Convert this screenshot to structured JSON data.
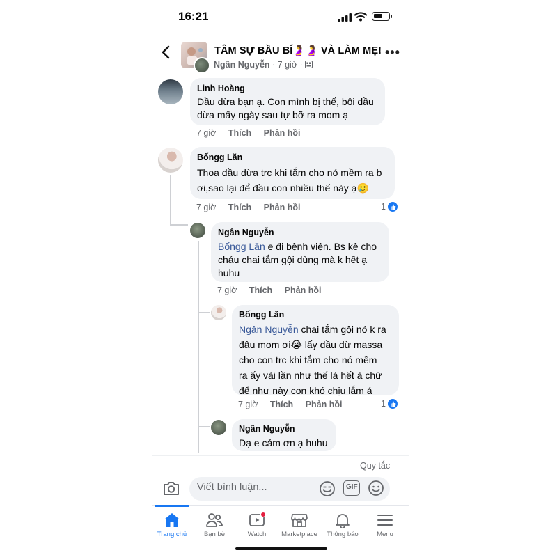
{
  "status_bar": {
    "time": "16:21"
  },
  "header": {
    "title": "TÂM SỰ BẦU BÍ🤰🤰 VÀ LÀM MẸ!",
    "author": "Ngân Nguyễn",
    "subtitle_time": " · 7 giờ · "
  },
  "comments": [
    {
      "name": "Linh Hoàng",
      "lines": [
        "Dầu dừa bạn ạ. Con mình bị thế, bôi dầu",
        "dừa mấy ngày sau tự bỡ ra mom ạ"
      ],
      "time": "7 giờ",
      "like": "Thích",
      "reply": "Phản hồi"
    },
    {
      "name": "Bốngg Lăn",
      "lines": [
        "Thoa dầu dừa trc khi tắm cho nó mềm ra b",
        "ơi,sao lại để đầu con nhiều thế này ạ🥲"
      ],
      "time": "7 giờ",
      "like": "Thích",
      "reply": "Phản hồi",
      "reactions": "1"
    },
    {
      "name": "Ngân Nguyễn",
      "mention": "Bốngg Lăn",
      "lines": [
        " e đi bệnh viện. Bs kê cho",
        "cháu chai tắm gội dùng mà k hết ạ",
        "huhu"
      ],
      "time": "7 giờ",
      "like": "Thích",
      "reply": "Phản hồi"
    },
    {
      "name": "Bốngg Lăn",
      "mention": "Ngân Nguyễn",
      "lines": [
        " chai tắm gội nó k ra",
        "đâu mom ơi😭 lấy dầu dừ massa",
        "cho con trc khi tắm cho nó mềm",
        "ra ấy vài lần như thế là hết à chứ",
        "để như này con khó chịu lắm á"
      ],
      "time": "7 giờ",
      "like": "Thích",
      "reply": "Phản hồi",
      "reactions": "1"
    },
    {
      "name": "Ngân Nguyễn",
      "lines": [
        "Dạ e cảm ơn ạ huhu"
      ]
    }
  ],
  "footer": {
    "rules": "Quy tắc",
    "comment_placeholder": "Viết bình luận...",
    "gif_label": "GIF"
  },
  "tabs": [
    {
      "label": "Trang chủ",
      "icon": "home-icon",
      "active": true
    },
    {
      "label": "Bạn bè",
      "icon": "friends-icon"
    },
    {
      "label": "Watch",
      "icon": "watch-icon"
    },
    {
      "label": "Marketplace",
      "icon": "marketplace-icon"
    },
    {
      "label": "Thông báo",
      "icon": "bell-icon"
    },
    {
      "label": "Menu",
      "icon": "menu-icon"
    }
  ],
  "colors": {
    "accent": "#1877f2",
    "bubble": "#f0f2f5",
    "muted": "#65676b",
    "mention": "#385898"
  }
}
